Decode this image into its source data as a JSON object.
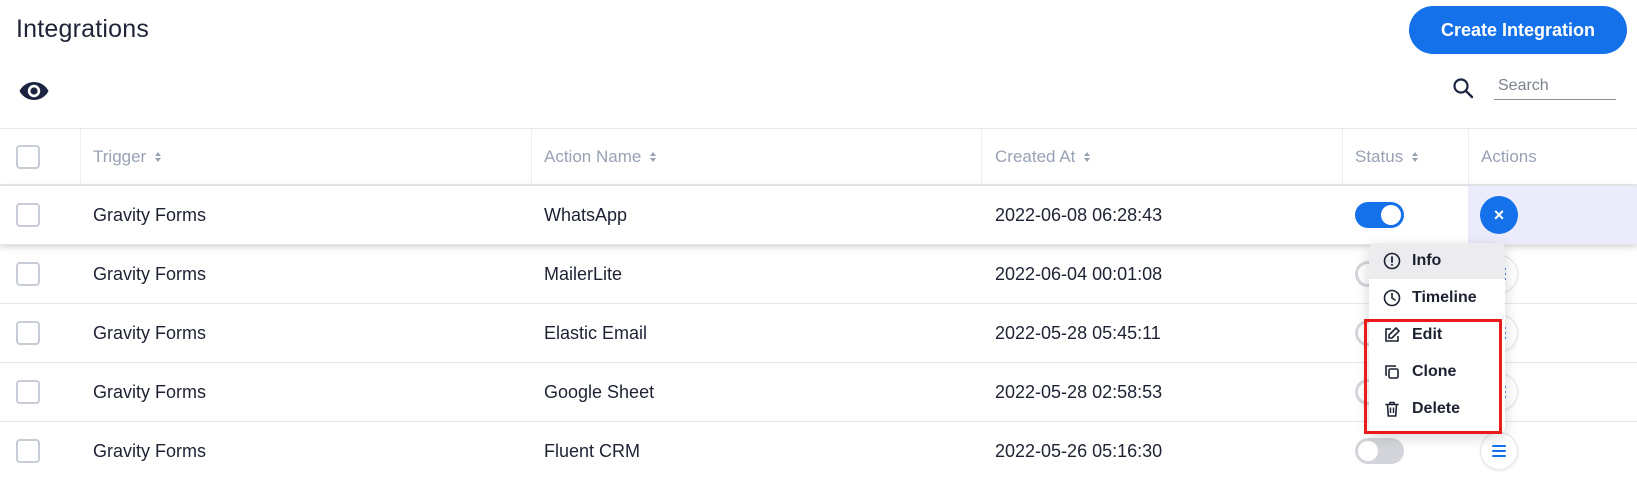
{
  "header": {
    "title": "Integrations",
    "create_button_label": "Create Integration",
    "brand_color": "#1471ea"
  },
  "toolbar": {
    "visibility_icon": "eye-icon",
    "search_icon": "search-icon",
    "search_placeholder": "Search"
  },
  "table": {
    "columns": [
      "Trigger",
      "Action Name",
      "Created At",
      "Status",
      "Actions"
    ],
    "rows": [
      {
        "trigger": "Gravity Forms",
        "action_name": "WhatsApp",
        "created_at": "2022-06-08 06:28:43",
        "status": true
      },
      {
        "trigger": "Gravity Forms",
        "action_name": "MailerLite",
        "created_at": "2022-06-04 00:01:08",
        "status": false
      },
      {
        "trigger": "Gravity Forms",
        "action_name": "Elastic Email",
        "created_at": "2022-05-28 05:45:11",
        "status": false
      },
      {
        "trigger": "Gravity Forms",
        "action_name": "Google Sheet",
        "created_at": "2022-05-28 02:58:53",
        "status": false
      },
      {
        "trigger": "Gravity Forms",
        "action_name": "Fluent CRM",
        "created_at": "2022-05-26 05:16:30",
        "status": false
      }
    ]
  },
  "actions_menu": {
    "items": [
      {
        "label": "Info",
        "icon": "info-icon"
      },
      {
        "label": "Timeline",
        "icon": "clock-icon"
      },
      {
        "label": "Edit",
        "icon": "edit-icon"
      },
      {
        "label": "Clone",
        "icon": "copy-icon"
      },
      {
        "label": "Delete",
        "icon": "trash-icon"
      }
    ],
    "close_symbol": "×"
  },
  "colors": {
    "accent": "#1471ea",
    "highlight": "#ea1b1b",
    "active_actions_bg": "#ecebfb"
  }
}
